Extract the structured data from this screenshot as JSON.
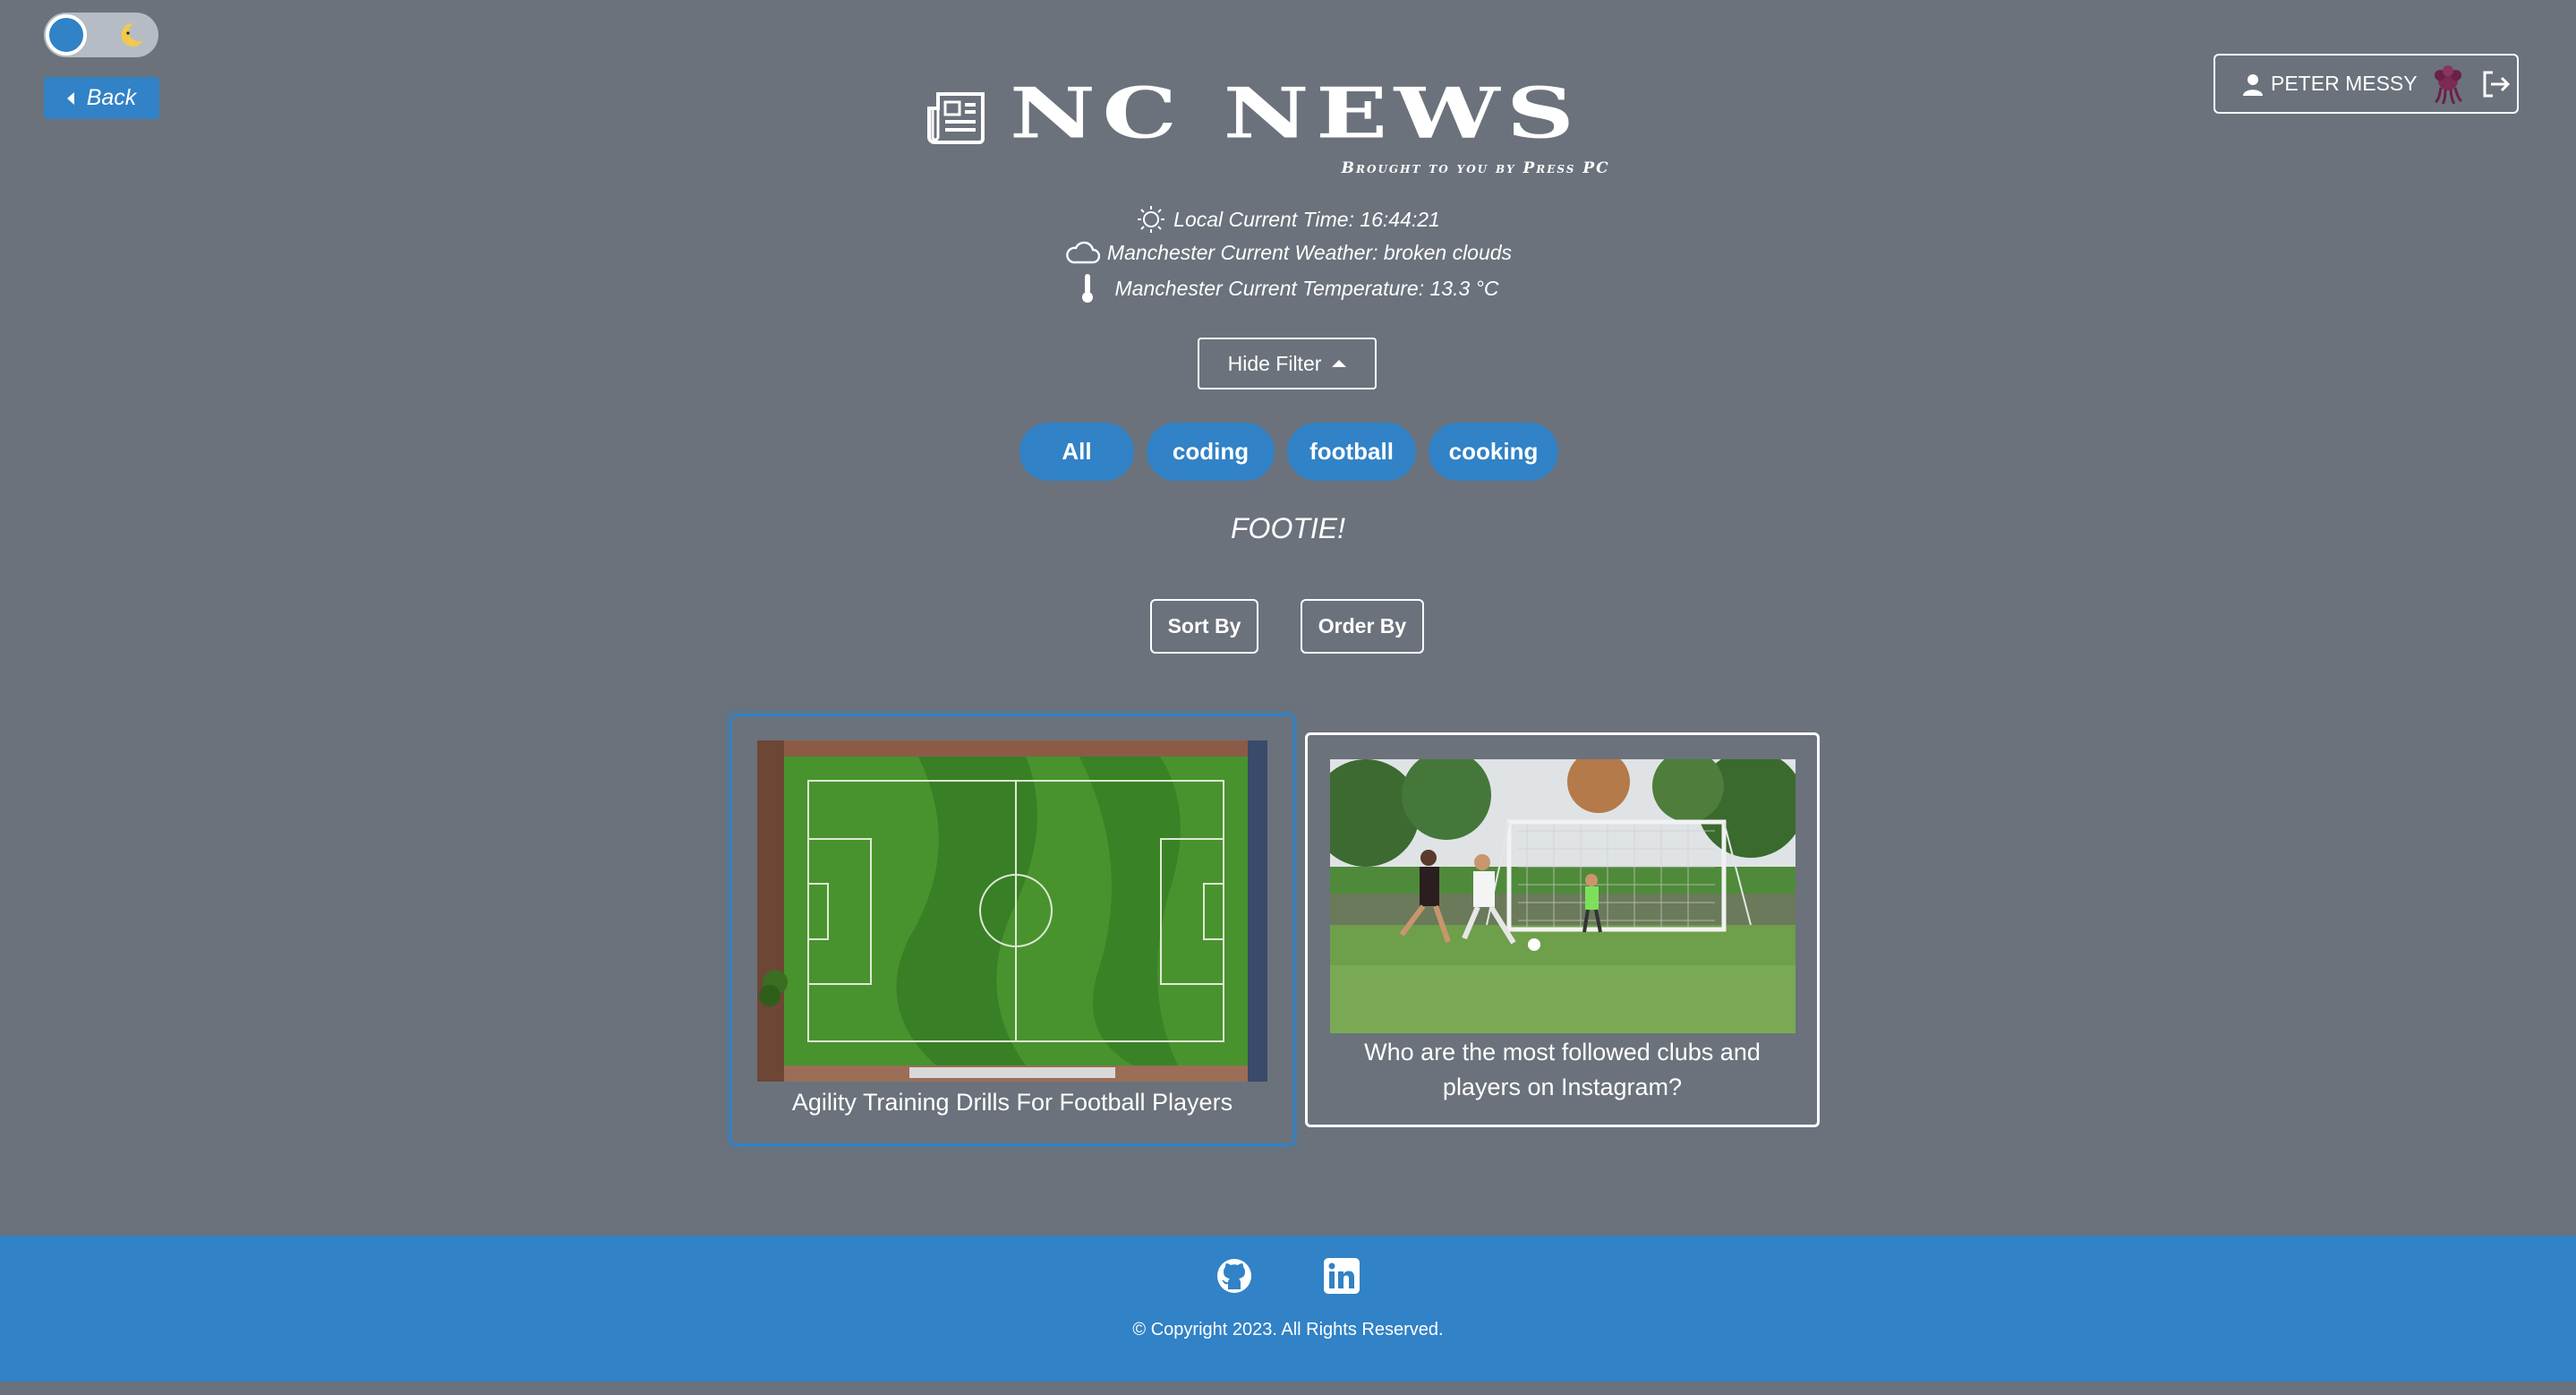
{
  "colors": {
    "background": "#6b727b",
    "accent": "#3182c6",
    "text": "#ffffff"
  },
  "theme_toggle": {
    "state": "light",
    "icon": "moon-icon"
  },
  "nav": {
    "back_label": "Back"
  },
  "user": {
    "name": "PETER MESSY",
    "user_icon": "user-icon",
    "logout_icon": "logout-icon"
  },
  "header": {
    "title": "NC NEWS",
    "tagline": "Brought to you by Press PC",
    "icon": "newspaper-icon"
  },
  "info": {
    "time": "Local Current Time: 16:44:21",
    "weather": "Manchester Current Weather: broken clouds",
    "temperature": "Manchester Current Temperature: 13.3 °C"
  },
  "filter": {
    "toggle_label": "Hide Filter"
  },
  "topics": [
    "All",
    "coding",
    "football",
    "cooking"
  ],
  "topic_title": "FOOTIE!",
  "controls": {
    "sort_label": "Sort By",
    "order_label": "Order By"
  },
  "articles": [
    {
      "title": "Agility Training Drills For Football Players"
    },
    {
      "title": "Who are the most followed clubs and players on Instagram?"
    }
  ],
  "footer": {
    "copyright": "© Copyright 2023. All Rights Reserved.",
    "icons": [
      "github-icon",
      "linkedin-icon"
    ]
  }
}
